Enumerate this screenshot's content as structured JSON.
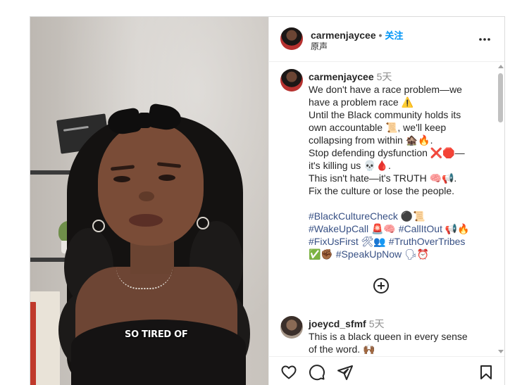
{
  "header": {
    "username": "carmenjaycee",
    "separator": "•",
    "follow_label": "关注",
    "audio_label": "原声",
    "more_label": "•••"
  },
  "video": {
    "caption": "SO TIRED OF"
  },
  "post_caption": {
    "username": "carmenjaycee",
    "time": "5天",
    "lines": [
      "We don't have a race problem—we",
      "have a problem race ⚠️",
      "Until the Black community holds its",
      "own accountable 📜, we'll keep",
      "collapsing from within 🏚️🔥.",
      "Stop defending dysfunction ❌🛑—",
      "it's killing us 💀🩸.",
      "This isn't hate—it's TRUTH 🧠📢.",
      "Fix the culture or lose the people."
    ],
    "hashtag_lines": [
      "#BlackCultureCheck ⚫📜",
      "#WakeUpCall 🚨🧠 #CallItOut 📢🔥",
      "#FixUsFirst 🛠👥 #TruthOverTribes",
      "✅✊🏾 #SpeakUpNow 🗣⏰"
    ]
  },
  "comment": {
    "username": "joeycd_sfmf",
    "time": "5天",
    "lines": [
      "This is a black queen in every sense",
      "of the word. 🙌🏾"
    ]
  },
  "actions": {
    "like_icon": "heart-outline",
    "comment_icon": "speech-bubble",
    "share_icon": "paper-plane",
    "save_icon": "bookmark-outline"
  },
  "colors": {
    "link": "#0095f6",
    "hashtag": "#385185",
    "muted": "#8e8e8e",
    "text": "#262626"
  }
}
